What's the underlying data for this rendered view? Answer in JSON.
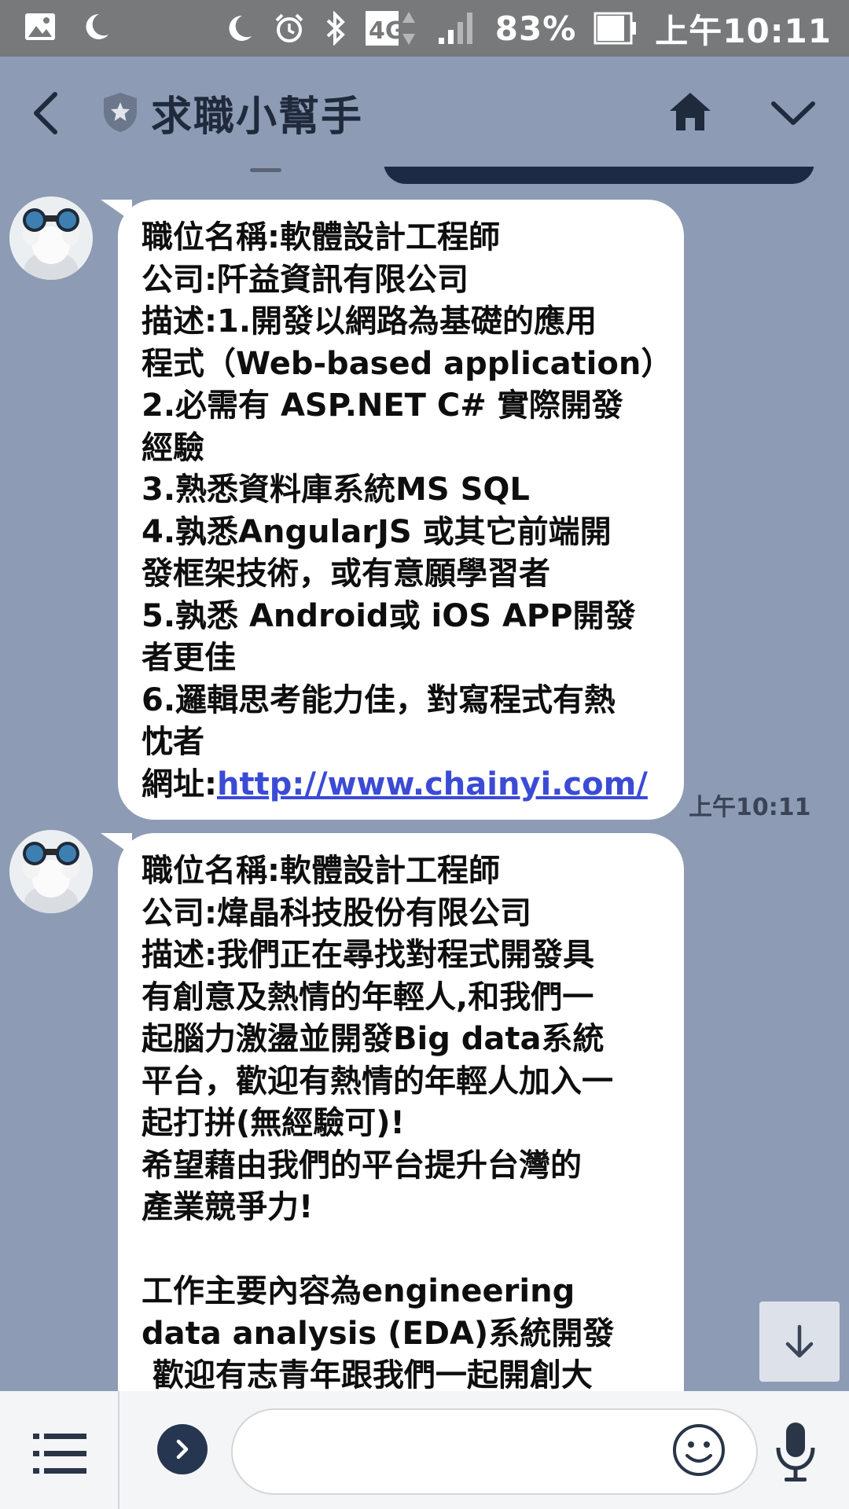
{
  "status_bar": {
    "network": "4G",
    "battery": "83%",
    "time": "上午10:11",
    "left_icons": [
      "image-icon",
      "moon-icon"
    ],
    "right_icons": [
      "moon-icon",
      "alarm-icon",
      "bluetooth-icon",
      "4g-icon",
      "signal-icon",
      "battery-icon"
    ]
  },
  "header": {
    "title": "求職小幫手",
    "icons": [
      "back-arrow-icon",
      "shield-star-icon",
      "home-icon",
      "chevron-down-icon"
    ]
  },
  "messages": [
    {
      "sender_avatar": "binoculars-job-avatar",
      "lines": [
        "職位名稱:軟體設計工程師",
        "公司:阡益資訊有限公司",
        "描述:1.開發以網路為基礎的應用",
        "程式（Web-based application）",
        "2.必需有 ASP.NET C# 實際開發",
        "經驗",
        "3.熟悉資料庫系統MS SQL",
        "4.孰悉AngularJS 或其它前端開",
        "發框架技術，或有意願學習者",
        "5.孰悉 Android或 iOS APP開發",
        "者更佳",
        "6.邏輯思考能力佳，對寫程式有熱",
        "忱者"
      ],
      "url_label": "網址:",
      "url": "http://www.chainyi.com/",
      "time": "上午10:11"
    },
    {
      "sender_avatar": "binoculars-job-avatar",
      "lines": [
        "職位名稱:軟體設計工程師",
        "公司:煒晶科技股份有限公司",
        "描述:我們正在尋找對程式開發具",
        "有創意及熱情的年輕人,和我們一",
        "起腦力激盪並開發Big data系統",
        "平台，歡迎有熱情的年輕人加入一",
        "起打拼(無經驗可)!",
        "希望藉由我們的平台提升台灣的",
        "產業競爭力!",
        "",
        "工作主要內容為engineering",
        "data analysis (EDA)系統開發",
        " 歡迎有志青年跟我們一起開創大"
      ]
    }
  ],
  "input": {
    "value": "",
    "placeholder": ""
  },
  "colors": {
    "chat_background": "#8d9cb4",
    "status_bar": "#78797b",
    "bubble": "#ffffff",
    "link": "#3b4bd6",
    "bottom_bar": "#f4f5f6"
  }
}
